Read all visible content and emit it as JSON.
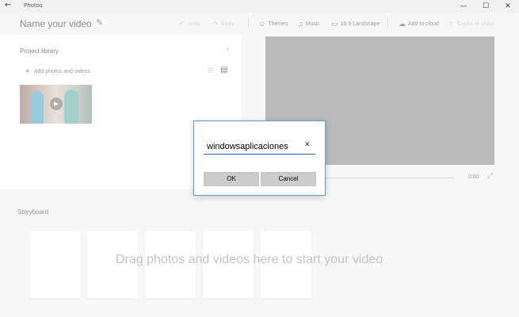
{
  "window": {
    "title": "Photos",
    "back_glyph": "←",
    "minimize_glyph": "—",
    "maximize_glyph": "☐",
    "close_glyph": "✕"
  },
  "toolbar": {
    "video_title": "Name your video",
    "undo": "Undo",
    "redo": "Redo",
    "themes": "Themes",
    "music": "Music",
    "aspect": "16:9 Landscape",
    "add_to_cloud": "Add to cloud",
    "export": "Export or share",
    "icons": [
      "pencil-icon",
      "undo-icon",
      "redo-icon",
      "themes-icon",
      "music-icon",
      "aspect-icon",
      "cloud-icon",
      "export-icon"
    ]
  },
  "library": {
    "title": "Project library",
    "add_label": "Add photos and videos"
  },
  "preview": {
    "time": "0:00"
  },
  "storyboard": {
    "label": "Storyboard",
    "hint": "Drag photos and videos here to start your video"
  },
  "dialog": {
    "input_value": "windowsaplicaciones",
    "ok": "OK",
    "cancel": "Cancel"
  },
  "colors": {
    "accent": "#1f6fc5",
    "dialog_border": "#5f9bd1",
    "preview_bg": "#898989"
  }
}
